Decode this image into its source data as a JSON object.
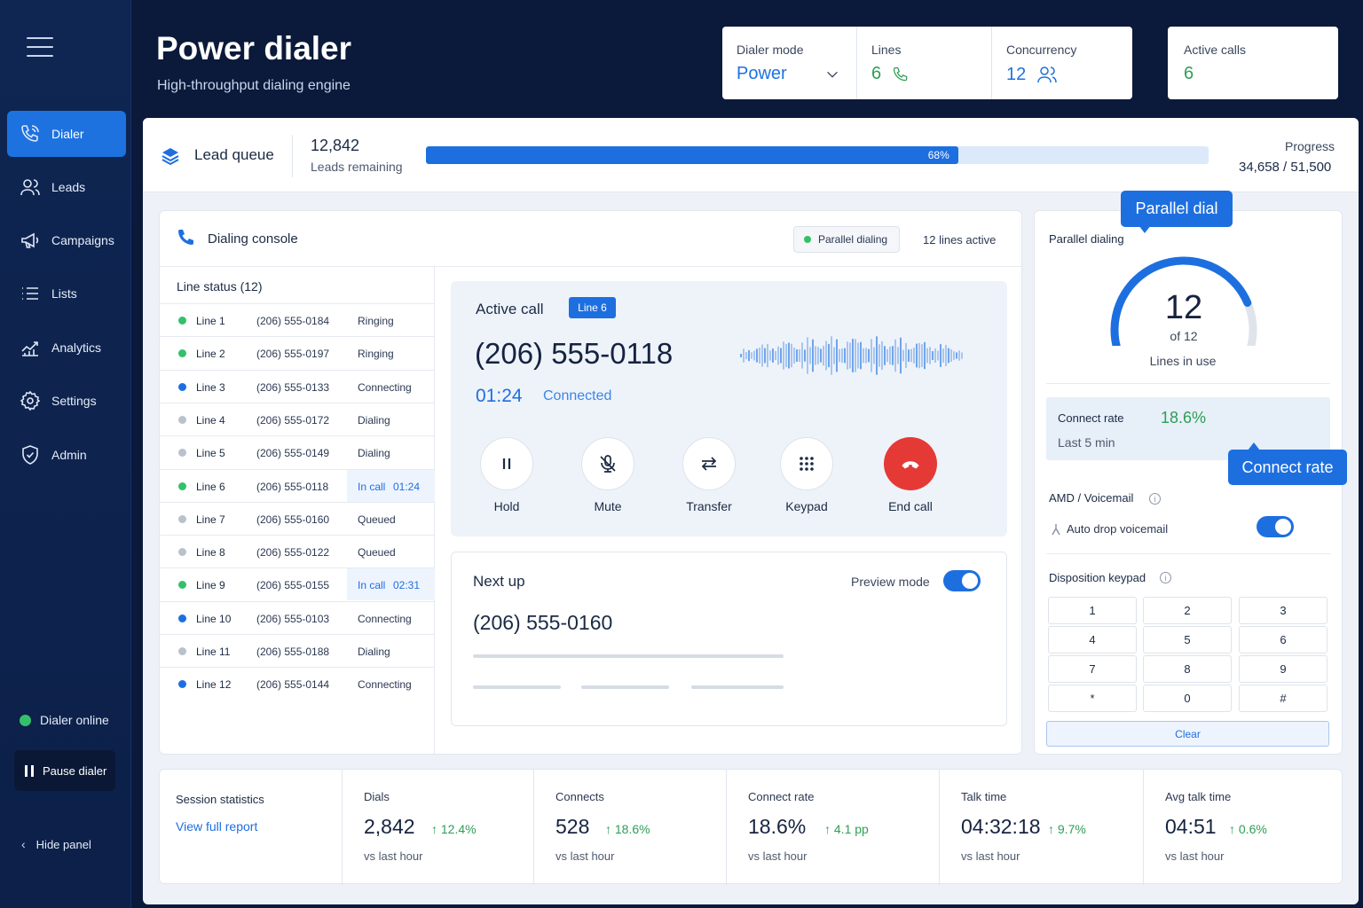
{
  "header": {
    "title": "Power dialer",
    "subtitle": "High-throughput dialing engine",
    "dialer_mode_label": "Dialer mode",
    "dialer_mode_value": "Power",
    "lines_label": "Lines",
    "lines_value": "6",
    "concurrency_label": "Concurrency",
    "concurrency_value": "12",
    "active_calls_label": "Active calls",
    "active_calls_value": "6"
  },
  "sidebar": {
    "items": [
      {
        "label": "Dialer",
        "icon": "phone-icon",
        "active": true
      },
      {
        "label": "Leads",
        "icon": "users-icon"
      },
      {
        "label": "Campaigns",
        "icon": "megaphone-icon"
      },
      {
        "label": "Lists",
        "icon": "list-icon"
      },
      {
        "label": "Analytics",
        "icon": "analytics-icon"
      },
      {
        "label": "Settings",
        "icon": "gear-icon"
      },
      {
        "label": "Admin",
        "icon": "shield-icon"
      }
    ],
    "status": "Dialer online",
    "pause_label": "Pause dialer",
    "hide_label": "Hide panel"
  },
  "lead_queue": {
    "title": "Lead queue",
    "count": "12,842",
    "count_label": "Leads remaining",
    "progress_fraction": 0.68,
    "progress_pct_text": "68%",
    "progress_label": "Progress",
    "progress_value": "34,658 / 51,500"
  },
  "console": {
    "title": "Dialing console",
    "pill": "Parallel dialing",
    "lines_active": "12 lines active",
    "line_status_title": "Line status (12)",
    "lines": [
      {
        "name": "Line 1",
        "number": "(206) 555-0184",
        "status": "Ringing",
        "dot": "#34c06a"
      },
      {
        "name": "Line 2",
        "number": "(206) 555-0197",
        "status": "Ringing",
        "dot": "#34c06a"
      },
      {
        "name": "Line 3",
        "number": "(206) 555-0133",
        "status": "Connecting",
        "dot": "#1d6fe0"
      },
      {
        "name": "Line 4",
        "number": "(206) 555-0172",
        "status": "Dialing",
        "dot": "#b9c1cd"
      },
      {
        "name": "Line 5",
        "number": "(206) 555-0149",
        "status": "Dialing",
        "dot": "#b9c1cd"
      },
      {
        "name": "Line 6",
        "number": "(206) 555-0118",
        "status": "In call",
        "time": "01:24",
        "dot": "#34c06a",
        "highlight": true
      },
      {
        "name": "Line 7",
        "number": "(206) 555-0160",
        "status": "Queued",
        "dot": "#b9c1cd"
      },
      {
        "name": "Line 8",
        "number": "(206) 555-0122",
        "status": "Queued",
        "dot": "#b9c1cd"
      },
      {
        "name": "Line 9",
        "number": "(206) 555-0155",
        "status": "In call",
        "time": "02:31",
        "dot": "#34c06a",
        "highlight": true
      },
      {
        "name": "Line 10",
        "number": "(206) 555-0103",
        "status": "Connecting",
        "dot": "#1d6fe0"
      },
      {
        "name": "Line 11",
        "number": "(206) 555-0188",
        "status": "Dialing",
        "dot": "#b9c1cd"
      },
      {
        "name": "Line 12",
        "number": "(206) 555-0144",
        "status": "Connecting",
        "dot": "#1d6fe0"
      }
    ]
  },
  "active_call": {
    "title": "Active call",
    "badge": "Line 6",
    "number": "(206) 555-0118",
    "timer": "01:24",
    "status": "Connected",
    "controls": [
      {
        "label": "Hold",
        "icon": "pause-icon"
      },
      {
        "label": "Mute",
        "icon": "mic-off-icon"
      },
      {
        "label": "Transfer",
        "icon": "transfer-icon"
      },
      {
        "label": "Keypad",
        "icon": "keypad-icon"
      },
      {
        "label": "End call",
        "icon": "hangup-icon"
      }
    ]
  },
  "next_up": {
    "title": "Next up",
    "preview_label": "Preview mode",
    "preview_on": true,
    "number": "(206) 555-0160"
  },
  "right_panel": {
    "callout_parallel": "Parallel dial",
    "parallel_label": "Parallel dialing",
    "gauge_value": "12",
    "gauge_of": "of 12",
    "gauge_fraction": 1.0,
    "gauge_caption": "Lines in use",
    "connect_rate_label": "Connect rate",
    "connect_rate_value": "18.6%",
    "connect_rate_sub": "Last 5 min",
    "callout_connect": "Connect rate",
    "amd_label": "AMD / Voicemail",
    "auto_drop_label": "Auto drop voicemail",
    "auto_drop_on": true,
    "keypad_label": "Disposition keypad",
    "keys": [
      "1",
      "2",
      "3",
      "4",
      "5",
      "6",
      "7",
      "8",
      "9",
      "*",
      "0",
      "#"
    ],
    "clear_label": "Clear"
  },
  "stats": {
    "title": "Session statistics",
    "link": "View full report",
    "items": [
      {
        "label": "Dials",
        "value": "2,842",
        "delta": "↑ 12.4%",
        "sub": "vs last hour"
      },
      {
        "label": "Connects",
        "value": "528",
        "delta": "↑ 18.6%",
        "sub": "vs last hour"
      },
      {
        "label": "Connect rate",
        "value": "18.6%",
        "delta": "↑ 4.1 pp",
        "sub": "vs last hour"
      },
      {
        "label": "Talk time",
        "value": "04:32:18",
        "delta": "↑ 9.7%",
        "sub": "vs last hour"
      },
      {
        "label": "Avg talk time",
        "value": "04:51",
        "delta": "↑ 0.6%",
        "sub": "vs last hour"
      }
    ]
  },
  "colors": {
    "accent": "#1d6fe0",
    "success": "#2e9e55",
    "danger": "#e53935",
    "background": "#0b1a3a"
  }
}
